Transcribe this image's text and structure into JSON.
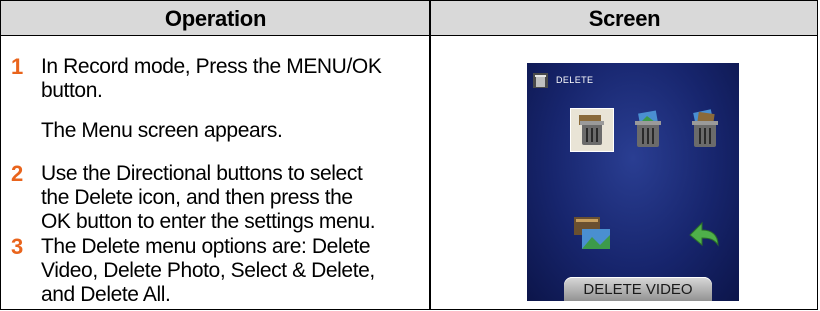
{
  "table": {
    "col_operation": "Operation",
    "col_screen": "Screen"
  },
  "steps": [
    {
      "number": "1",
      "lines": [
        "In Record mode, Press the MENU/OK",
        "button."
      ]
    },
    {
      "note": "The Menu screen appears."
    },
    {
      "number": "2",
      "lines": [
        "Use the Directional buttons to select",
        "the Delete icon, and then press the",
        "OK button to enter the settings menu."
      ]
    },
    {
      "number": "3",
      "lines": [
        "The Delete menu options are: Delete",
        "Video, Delete Photo, Select & Delete,",
        "and Delete All."
      ]
    }
  ],
  "camera_screen": {
    "title": "DELETE",
    "button_label": "DELETE VIDEO",
    "icons": [
      "delete-video-icon",
      "delete-photo-icon",
      "delete-all-icon",
      "select-delete-icon",
      "return-icon"
    ],
    "colors": {
      "background": "#17256d",
      "accent_step_number": "#e9641c"
    }
  }
}
